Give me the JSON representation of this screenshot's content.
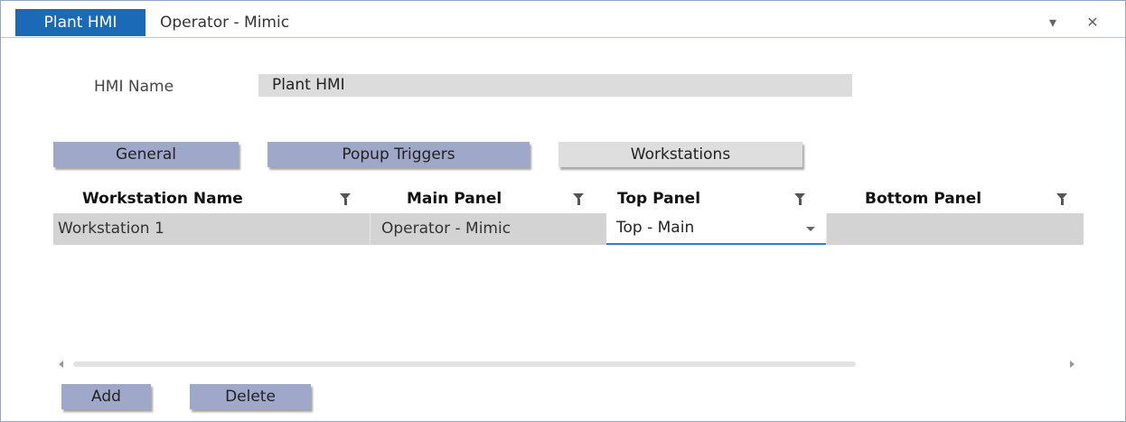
{
  "window": {
    "active_tab": "Plant HMI",
    "title": "Operator - Mimic",
    "dropdown_icon": "chevron-down-icon",
    "close_icon": "close-icon",
    "close_glyph": "✕",
    "menu_glyph": "▾"
  },
  "form": {
    "hmi_name_label": "HMI Name",
    "hmi_name_value": "Plant HMI"
  },
  "section_buttons": {
    "general": "General",
    "popup_triggers": "Popup Triggers",
    "workstations": "Workstations"
  },
  "grid": {
    "columns": [
      "Workstation Name",
      "Main Panel",
      "Top Panel",
      "Bottom Panel"
    ],
    "rows": [
      {
        "workstation_name": "Workstation 1",
        "main_panel": "Operator - Mimic",
        "top_panel": "Top - Main",
        "bottom_panel": ""
      }
    ]
  },
  "actions": {
    "add": "Add",
    "delete": "Delete"
  },
  "colors": {
    "accent": "#1a6ab8",
    "tab_button": "#9fa8c9",
    "selected_tab_button": "#dedede",
    "row_background": "#d3d3d3",
    "focus_underline": "#2f7fd0"
  }
}
